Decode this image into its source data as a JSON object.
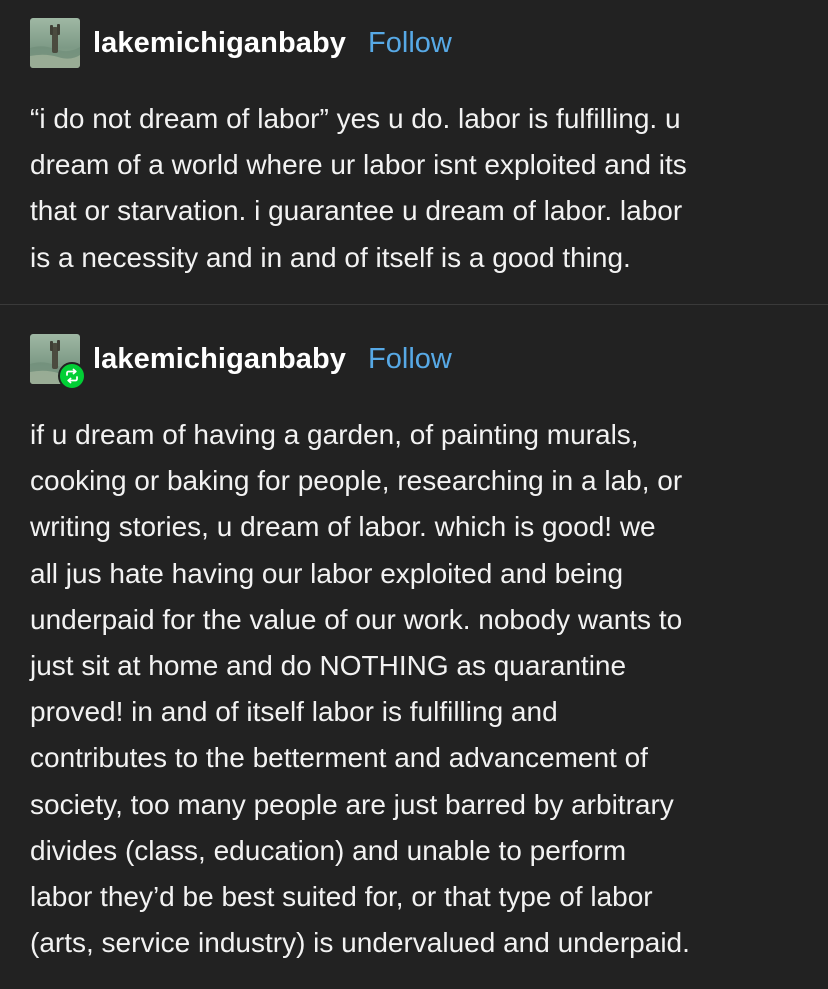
{
  "posts": [
    {
      "username": "lakemichiganbaby",
      "follow_label": "Follow",
      "avatar_icon": "lake-avatar-icon",
      "lines": [
        "“i do not dream of labor” yes u do. labor is fulfilling. u",
        "dream of a world where ur labor isnt exploited and its",
        "that or starvation. i guarantee u dream of labor. labor",
        "is a necessity and in and of itself is a good thing."
      ]
    },
    {
      "username": "lakemichiganbaby",
      "follow_label": "Follow",
      "avatar_icon": "lake-avatar-icon",
      "badge_icon": "reblog-icon",
      "lines": [
        "if u dream of having a garden, of painting murals,",
        "cooking or baking for people, researching in a lab, or",
        "writing stories, u dream of labor. which is good! we",
        "all jus hate having our labor exploited and being",
        "underpaid for the value of our work. nobody wants to",
        "just sit at home and do NOTHING as quarantine",
        "proved! in and of itself labor is fulfilling and",
        "contributes to the betterment and advancement of",
        "society, too many people are just barred by arbitrary",
        "divides (class, education) and unable to perform",
        "labor they’d be best suited for, or that type of labor",
        "(arts, service industry) is undervalued and underpaid."
      ]
    }
  ],
  "colors": {
    "background": "#222222",
    "text": "#f2f2f2",
    "follow": "#57a9e6",
    "reblog_badge": "#01cf35",
    "divider": "#3a3a3a"
  }
}
